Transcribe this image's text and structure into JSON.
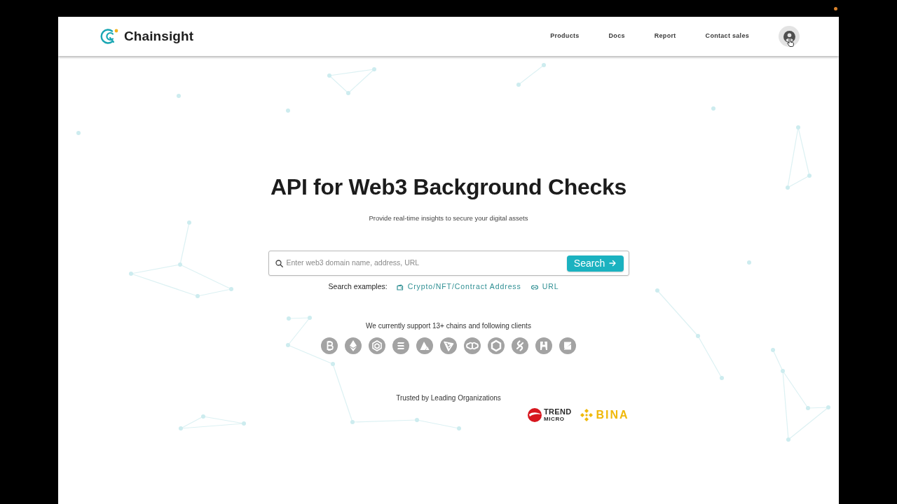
{
  "header": {
    "logo_text": "Chainsight",
    "nav": [
      "Products",
      "Docs",
      "Report",
      "Contact sales"
    ]
  },
  "hero": {
    "title": "API for Web3 Background Checks",
    "subtitle": "Provide real-time insights to secure your digital assets"
  },
  "search": {
    "placeholder": "Enter web3 domain name, address, URL",
    "button": "Search",
    "examples_label": "Search examples:",
    "examples": [
      {
        "kind": "wallet",
        "label": "Crypto/NFT/Contract Address"
      },
      {
        "kind": "link",
        "label": "URL"
      }
    ]
  },
  "chains": {
    "caption": "We currently support 13+ chains and following clients"
  },
  "trusted": {
    "caption": "Trusted by Leading Organizations",
    "logos": [
      {
        "kind": "ball",
        "lines": [
          "TREND",
          "MICRO"
        ]
      },
      {
        "kind": "diamond",
        "lines": [
          "BINA"
        ]
      }
    ]
  }
}
